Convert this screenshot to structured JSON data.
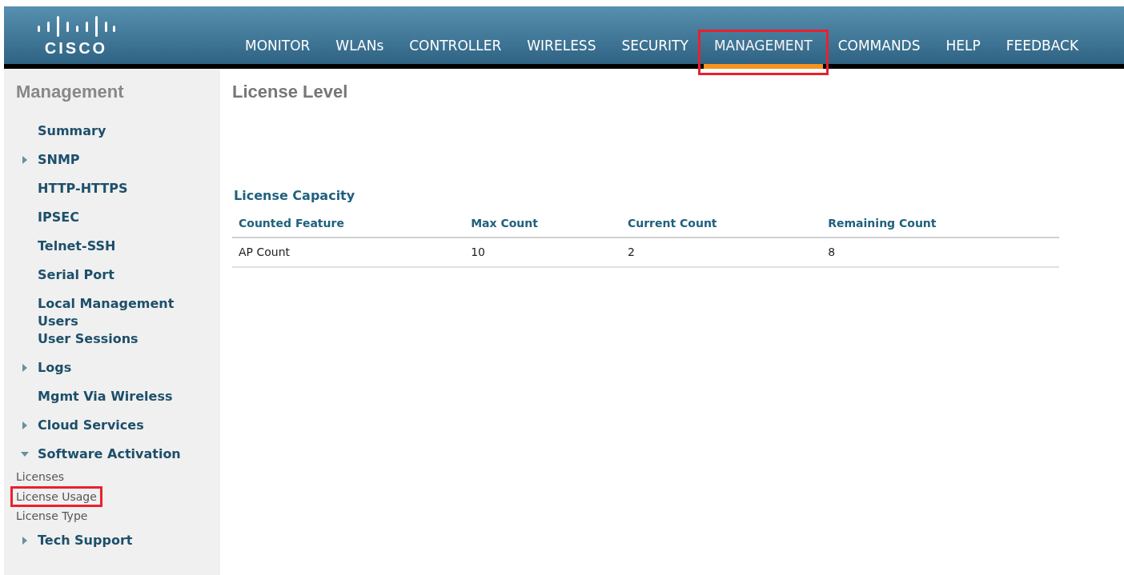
{
  "header": {
    "logo": "CISCO",
    "nav": [
      {
        "label": "MONITOR",
        "selected": false,
        "highlighted": false
      },
      {
        "label": "WLANs",
        "selected": false,
        "highlighted": false
      },
      {
        "label": "CONTROLLER",
        "selected": false,
        "highlighted": false
      },
      {
        "label": "WIRELESS",
        "selected": false,
        "highlighted": false
      },
      {
        "label": "SECURITY",
        "selected": false,
        "highlighted": false
      },
      {
        "label": "MANAGEMENT",
        "selected": true,
        "highlighted": true
      },
      {
        "label": "COMMANDS",
        "selected": false,
        "highlighted": false
      },
      {
        "label": "HELP",
        "selected": false,
        "highlighted": false
      },
      {
        "label": "FEEDBACK",
        "selected": false,
        "highlighted": false
      }
    ]
  },
  "sidebar": {
    "title": "Management",
    "items": [
      {
        "label": "Summary",
        "kind": "link"
      },
      {
        "label": "SNMP",
        "kind": "folder",
        "expanded": false
      },
      {
        "label": "HTTP-HTTPS",
        "kind": "link"
      },
      {
        "label": "IPSEC",
        "kind": "link"
      },
      {
        "label": "Telnet-SSH",
        "kind": "link"
      },
      {
        "label": "Serial Port",
        "kind": "link"
      },
      {
        "label": "Local Management Users",
        "kind": "link"
      },
      {
        "label": "User Sessions",
        "kind": "link"
      },
      {
        "label": "Logs",
        "kind": "folder",
        "expanded": false
      },
      {
        "label": "Mgmt Via Wireless",
        "kind": "link"
      },
      {
        "label": "Cloud Services",
        "kind": "folder",
        "expanded": false
      },
      {
        "label": "Software Activation",
        "kind": "folder",
        "expanded": true,
        "children": [
          {
            "label": "Licenses",
            "highlighted": false
          },
          {
            "label": "License Usage",
            "highlighted": true
          },
          {
            "label": "License Type",
            "highlighted": false
          }
        ]
      },
      {
        "label": "Tech Support",
        "kind": "folder",
        "expanded": false
      }
    ]
  },
  "main": {
    "title": "License Level",
    "section_title": "License Capacity",
    "table": {
      "columns": [
        "Counted Feature",
        "Max Count",
        "Current Count",
        "Remaining Count"
      ],
      "rows": [
        [
          "AP Count",
          "10",
          "2",
          "8"
        ]
      ]
    }
  }
}
